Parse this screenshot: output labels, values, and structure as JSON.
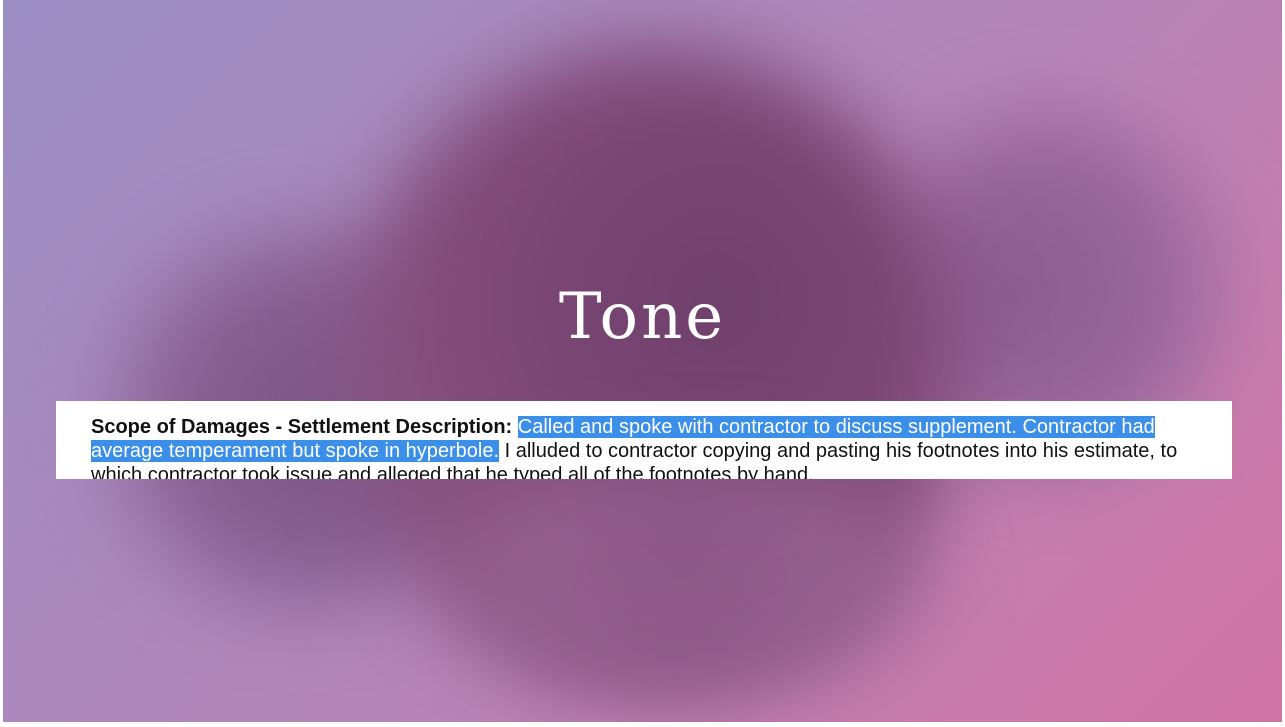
{
  "slide": {
    "title": "Tone",
    "excerpt": {
      "label": "Scope of Damages - Settlement Description:",
      "highlighted_text": "Called and spoke with contractor to discuss supplement. Contractor had average temperament but spoke in hyperbole.",
      "body_text": "I alluded to contractor copying and pasting his footnotes into his estimate, to which contractor took issue and alleged that he typed all of the footnotes by hand."
    }
  }
}
